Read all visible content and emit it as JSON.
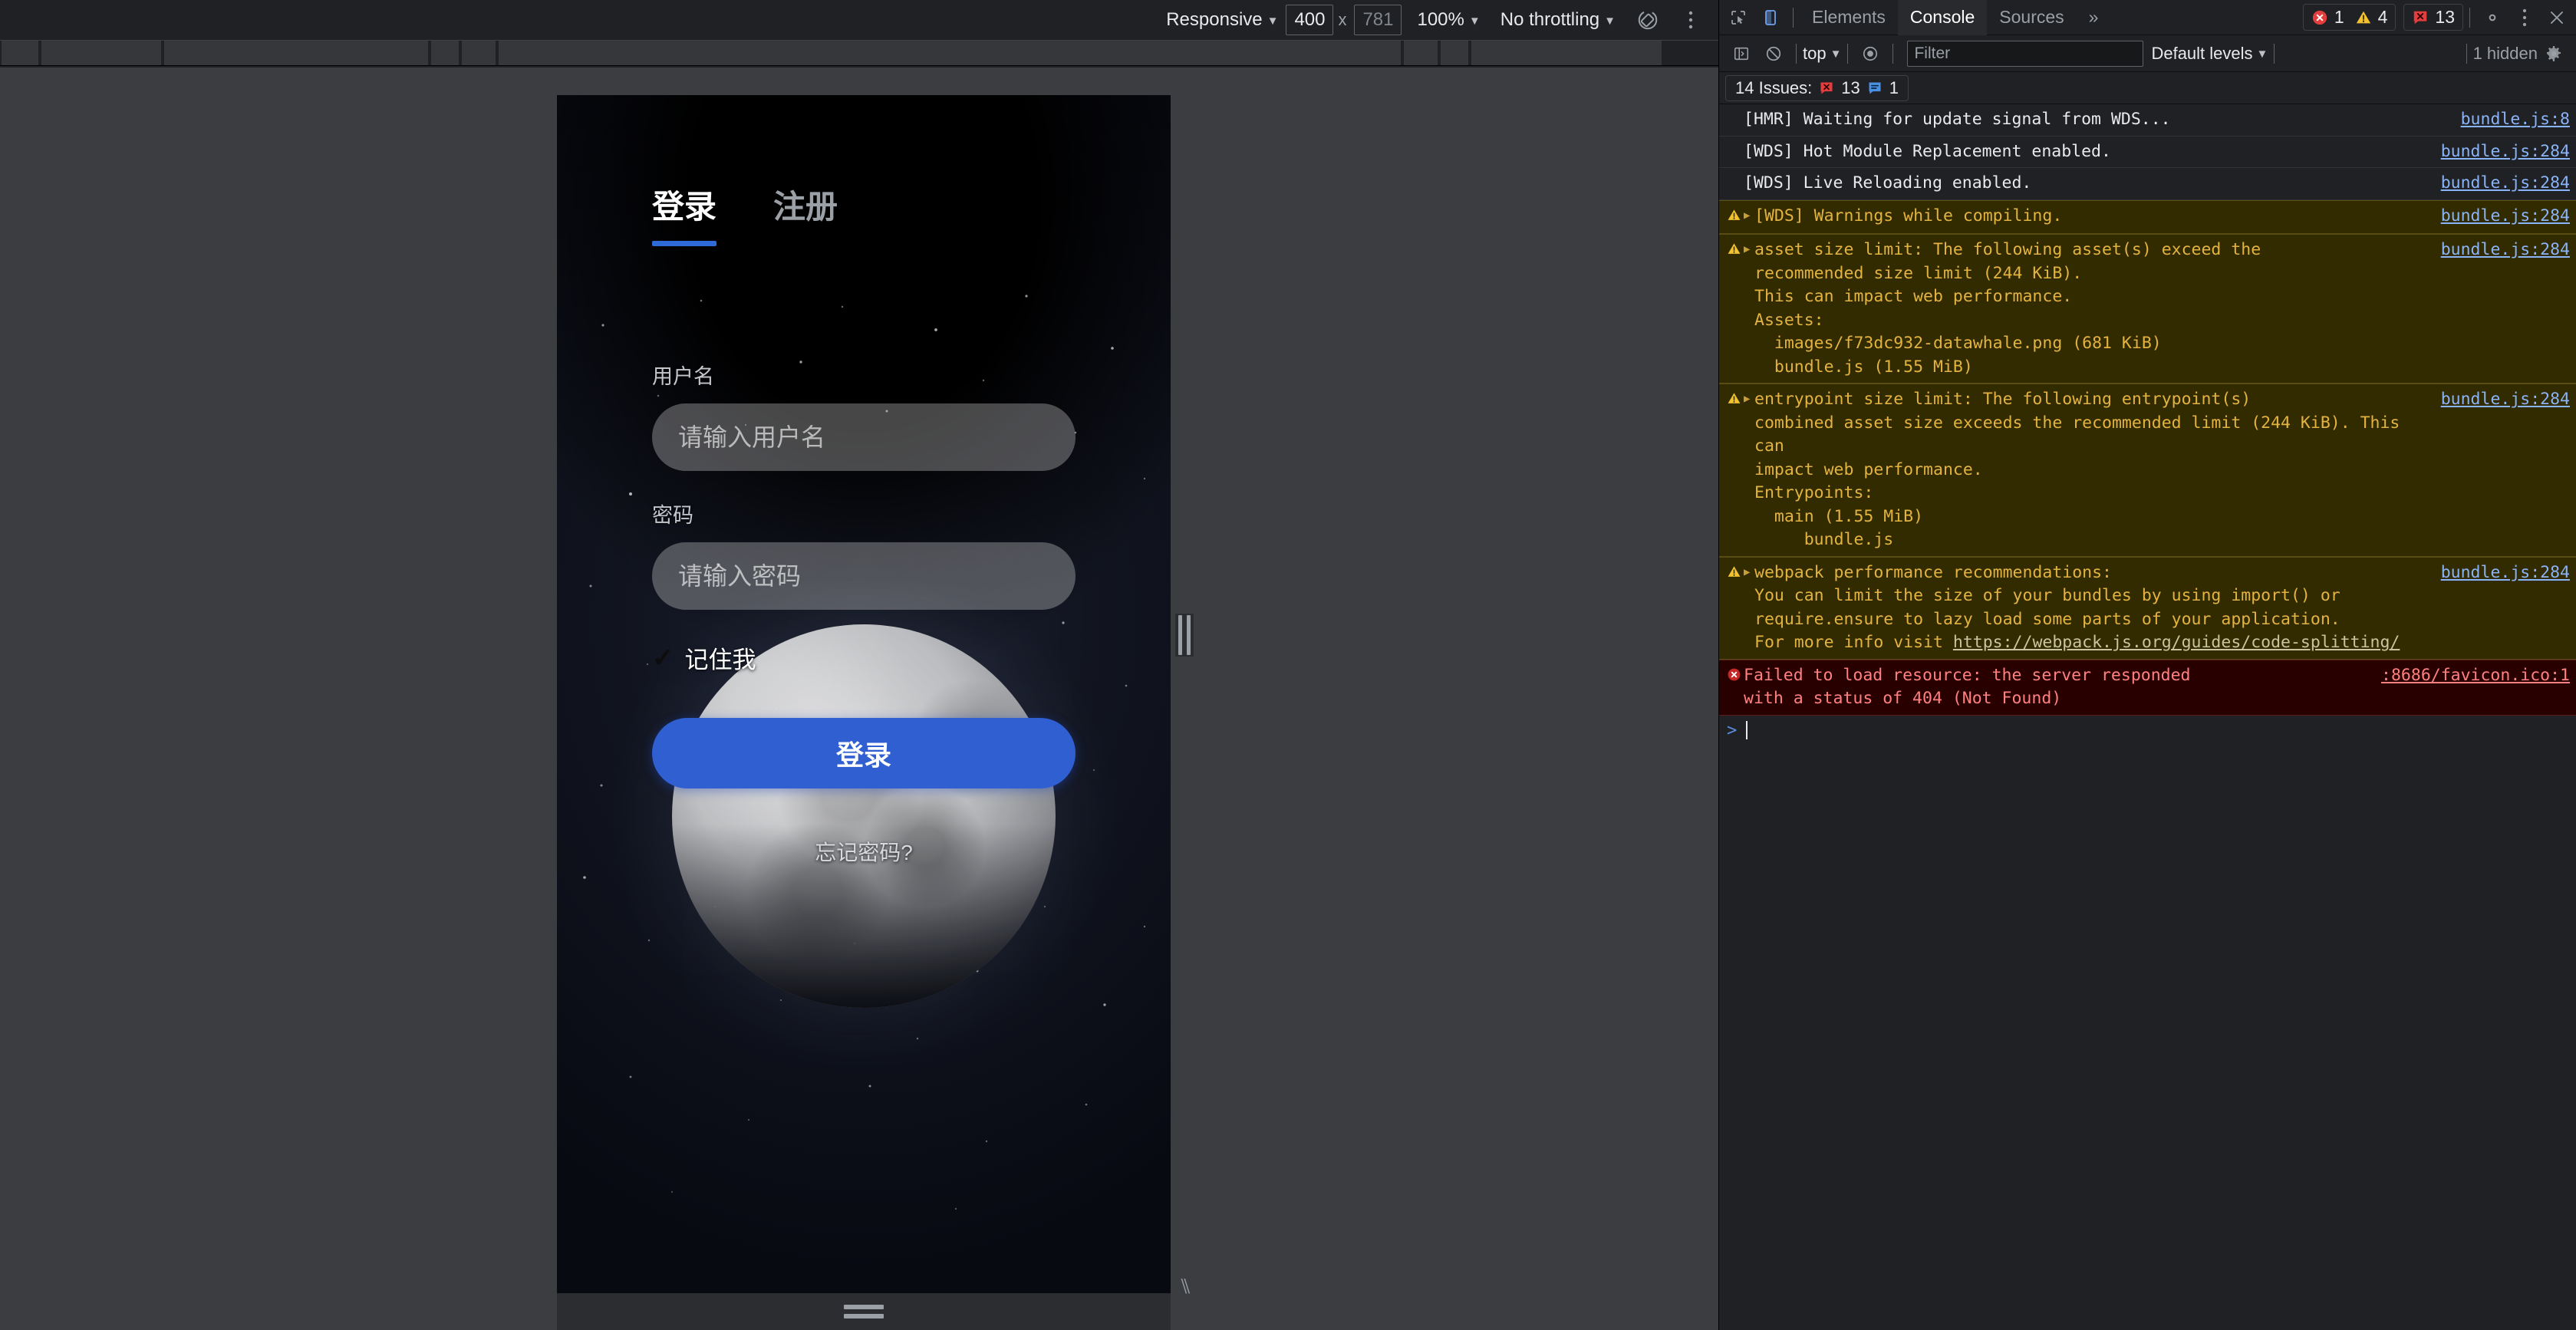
{
  "device_toolbar": {
    "device_preset": "Responsive",
    "width": "400",
    "height_placeholder": "781",
    "height_value": "781",
    "zoom": "100%",
    "throttling": "No throttling",
    "rotate_icon": "rotate-device-icon",
    "more_options_icon": "more-options-icon"
  },
  "emulated_page": {
    "tabs": [
      {
        "label": "登录",
        "active": true
      },
      {
        "label": "注册",
        "active": false
      }
    ],
    "username": {
      "label": "用户名",
      "placeholder": "请输入用户名",
      "value": ""
    },
    "password": {
      "label": "密码",
      "placeholder": "请输入密码",
      "value": ""
    },
    "remember": {
      "label": "记住我",
      "checked": true,
      "check_glyph": "✓"
    },
    "login_button": "登录",
    "forgot_link": "忘记密码?",
    "accent_color": "#2f5fd0",
    "tab_underline_color": "#2f6bd8"
  },
  "devtools": {
    "tabbar": {
      "inspect_icon": "inspect-element-icon",
      "device_toggle_icon": "toggle-device-toolbar-icon",
      "tabs": [
        {
          "label": "Elements",
          "active": false
        },
        {
          "label": "Console",
          "active": true
        },
        {
          "label": "Sources",
          "active": false
        }
      ],
      "more_tabs": "»",
      "error_count": "1",
      "warning_count": "4",
      "issue_count": "13",
      "settings_icon": "gear-icon",
      "menu_icon": "more-vertical-icon",
      "close_icon": "close-icon"
    },
    "console_toolbar": {
      "sidebar_icon": "console-sidebar-icon",
      "clear_icon": "clear-console-icon",
      "context": "top",
      "eye_icon": "live-expression-icon",
      "filter_placeholder": "Filter",
      "filter_value": "",
      "levels": "Default levels",
      "hidden_text": "1 hidden",
      "settings_icon": "console-settings-icon"
    },
    "issues_bar": {
      "title": "14 Issues:",
      "error_count": "13",
      "info_count": "1"
    },
    "console_messages": [
      {
        "level": "info",
        "expandable": false,
        "text": "[HMR] Waiting for update signal from WDS...",
        "source": "bundle.js:8"
      },
      {
        "level": "info",
        "expandable": false,
        "text": "[WDS] Hot Module Replacement enabled.",
        "source": "bundle.js:284"
      },
      {
        "level": "info",
        "expandable": false,
        "text": "[WDS] Live Reloading enabled.",
        "source": "bundle.js:284"
      },
      {
        "level": "warn",
        "expandable": true,
        "text": "[WDS] Warnings while compiling.",
        "source": "bundle.js:284"
      },
      {
        "level": "warn",
        "expandable": true,
        "text": "asset size limit: The following asset(s) exceed the\nrecommended size limit (244 KiB).\nThis can impact web performance.\nAssets:\n  images/f73dc932-datawhale.png (681 KiB)\n  bundle.js (1.55 MiB)",
        "source": "bundle.js:284"
      },
      {
        "level": "warn",
        "expandable": true,
        "text": "entrypoint size limit: The following entrypoint(s)\ncombined asset size exceeds the recommended limit (244 KiB). This can\nimpact web performance.\nEntrypoints:\n  main (1.55 MiB)\n     bundle.js",
        "source": "bundle.js:284"
      },
      {
        "level": "warn",
        "expandable": true,
        "text": "webpack performance recommendations:\nYou can limit the size of your bundles by using import() or\nrequire.ensure to lazy load some parts of your application.\nFor more info visit ",
        "link": "https://webpack.js.org/guides/code-splitting/",
        "source": "bundle.js:284"
      },
      {
        "level": "error",
        "expandable": false,
        "text": "Failed to load resource: the server responded\nwith a status of 404 (Not Found)",
        "source": ":8686/favicon.ico:1"
      }
    ],
    "prompt": {
      "caret": ">",
      "value": ""
    }
  }
}
